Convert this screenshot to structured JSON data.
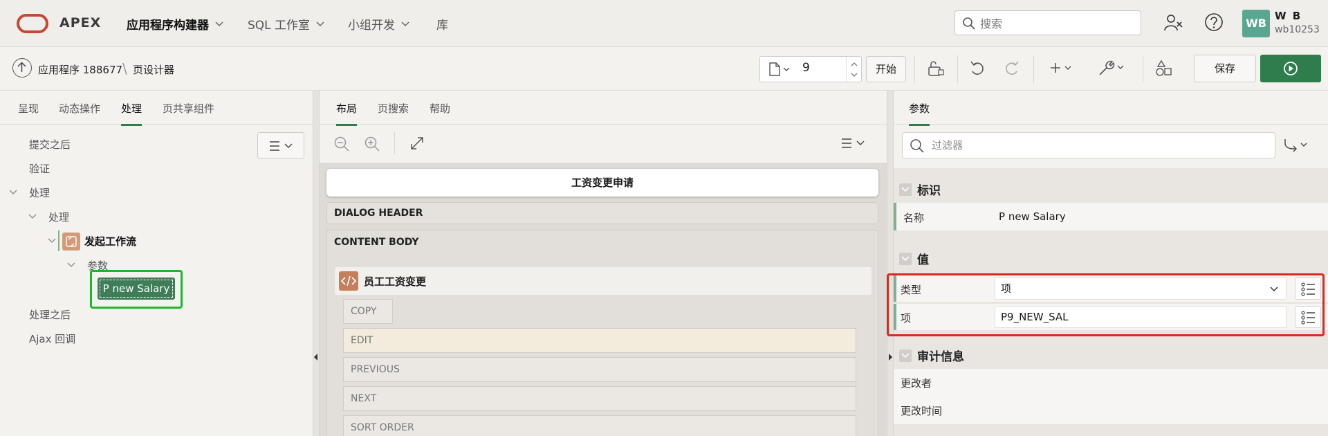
{
  "topnav": {
    "brand": "APEX",
    "items": [
      {
        "label": "应用程序构建器",
        "has_menu": true
      },
      {
        "label": "SQL 工作室",
        "has_menu": true
      },
      {
        "label": "小组开发",
        "has_menu": true
      },
      {
        "label": "库",
        "has_menu": false
      }
    ],
    "search_placeholder": "搜索",
    "user": {
      "initials": "WB",
      "name": "W B",
      "id": "wb10253"
    }
  },
  "toolbar": {
    "breadcrumb": {
      "app": "应用程序 188677",
      "page": "页设计器"
    },
    "page_number": "9",
    "go_label": "开始",
    "save_label": "保存"
  },
  "left_panel": {
    "tabs": [
      "呈现",
      "动态操作",
      "处理",
      "页共享组件"
    ],
    "active_tab": "处理",
    "tree": {
      "after_submit": "提交之后",
      "validation": "验证",
      "processing": "处理",
      "processing_sub": "处理",
      "workflow": "发起工作流",
      "params": "参数",
      "selected_param": "P new Salary",
      "after_processing": "处理之后",
      "ajax": "Ajax 回调"
    }
  },
  "center_panel": {
    "tabs": [
      "布局",
      "页搜索",
      "帮助"
    ],
    "active_tab": "布局",
    "dialog_title": "工资变更申请",
    "dialog_header": "DIALOG HEADER",
    "content_body": "CONTENT BODY",
    "region_title": "员工工资变更",
    "button_slots": [
      "COPY",
      "EDIT",
      "PREVIOUS",
      "NEXT",
      "SORT ORDER"
    ]
  },
  "right_panel": {
    "tabs": [
      "参数"
    ],
    "active_tab": "参数",
    "filter_placeholder": "过滤器",
    "groups": {
      "identity": {
        "title": "标识",
        "name_label": "名称",
        "name_value": "P new Salary"
      },
      "value": {
        "title": "值",
        "type_label": "类型",
        "type_value": "项",
        "item_label": "项",
        "item_value": "P9_NEW_SAL"
      },
      "audit": {
        "title": "审计信息",
        "changed_by": "更改者",
        "changed_on": "更改时间"
      }
    }
  },
  "colors": {
    "accent": "#2f7d4d",
    "highlight_green": "#18b82a",
    "highlight_red": "#e1251b",
    "logo_red": "#c74634"
  }
}
